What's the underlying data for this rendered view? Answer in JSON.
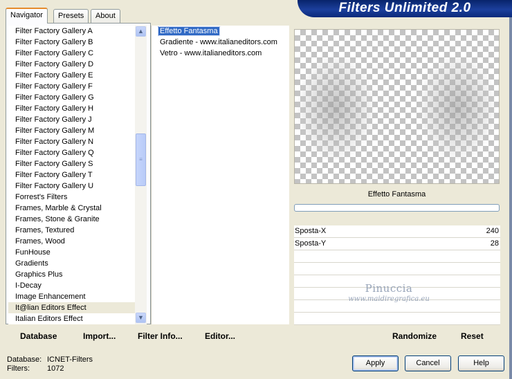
{
  "header": {
    "title": "Filters Unlimited 2.0"
  },
  "tabs": [
    {
      "label": "Navigator",
      "active": true
    },
    {
      "label": "Presets",
      "active": false
    },
    {
      "label": "About",
      "active": false
    }
  ],
  "categories": {
    "items": [
      "Filter Factory Gallery A",
      "Filter Factory Gallery B",
      "Filter Factory Gallery C",
      "Filter Factory Gallery D",
      "Filter Factory Gallery E",
      "Filter Factory Gallery F",
      "Filter Factory Gallery G",
      "Filter Factory Gallery H",
      "Filter Factory Gallery J",
      "Filter Factory Gallery M",
      "Filter Factory Gallery N",
      "Filter Factory Gallery Q",
      "Filter Factory Gallery S",
      "Filter Factory Gallery T",
      "Filter Factory Gallery U",
      "Forrest's Filters",
      "Frames, Marble & Crystal",
      "Frames, Stone & Granite",
      "Frames, Textured",
      "Frames, Wood",
      "FunHouse",
      "Gradients",
      "Graphics Plus",
      "I-Decay",
      "Image Enhancement",
      "It@lian Editors Effect",
      "Italian Editors Effect"
    ],
    "selected": "It@lian Editors Effect"
  },
  "filters": {
    "items": [
      "Effetto Fantasma",
      "Gradiente - www.italianeditors.com",
      "Vetro - www.italianeditors.com"
    ],
    "selected": "Effetto Fantasma"
  },
  "preview": {
    "filter_name": "Effetto Fantasma"
  },
  "params": [
    {
      "name": "Sposta-X",
      "value": "240"
    },
    {
      "name": "Sposta-Y",
      "value": "28"
    }
  ],
  "watermark": {
    "name": "Pinuccia",
    "site": "www.maidiregrafica.eu"
  },
  "toolbar": {
    "database": "Database",
    "import": "Import...",
    "filter_info": "Filter Info...",
    "editor": "Editor...",
    "randomize": "Randomize",
    "reset": "Reset"
  },
  "status": {
    "database_label": "Database:",
    "database_value": "ICNET-Filters",
    "filters_label": "Filters:",
    "filters_value": "1072"
  },
  "buttons": {
    "apply": "Apply",
    "cancel": "Cancel",
    "help": "Help"
  },
  "colors": {
    "banner": "#08246b",
    "selection": "#316ac5",
    "tab_accent": "#e68b2c"
  }
}
